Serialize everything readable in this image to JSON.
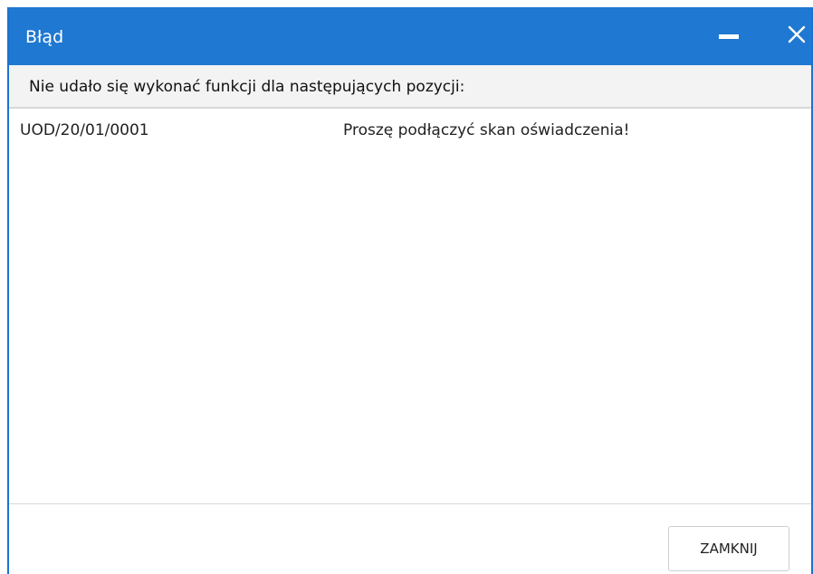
{
  "window": {
    "title": "Błąd",
    "accent_color": "#1f78d1"
  },
  "message": "Nie udało się wykonać funkcji dla następujących pozycji:",
  "items": [
    {
      "id": "UOD/20/01/0001",
      "message": "Proszę podłączyć skan oświadczenia!"
    }
  ],
  "footer": {
    "close_label": "ZAMKNIJ"
  },
  "icons": {
    "minimize": "minimize-icon",
    "close": "close-icon"
  }
}
